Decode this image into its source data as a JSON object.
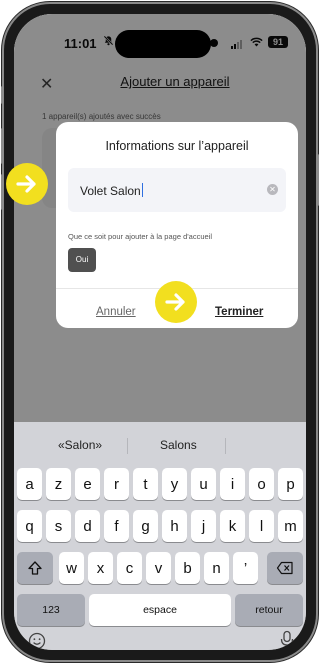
{
  "status_bar": {
    "time": "11:01",
    "mute_icon": "bell-slash-icon",
    "battery": "91"
  },
  "app": {
    "close_icon": "close-icon",
    "title": "Ajouter un appareil",
    "success_text": "1 appareil(s) ajoutés avec succès"
  },
  "dialog": {
    "title": "Informations sur l’appareil",
    "name_value": "Volet Salon",
    "clear_icon": "clear-icon",
    "hint": "Que ce soit pour ajouter à la page d'accueil",
    "yes_label": "Oui",
    "cancel_label": "Annuler",
    "finish_label": "Terminer"
  },
  "markers": {
    "color": "#f2df1f",
    "icon": "arrow-right-icon"
  },
  "keyboard": {
    "suggestions": [
      "«Salon»",
      "Salons",
      ""
    ],
    "row1": [
      "a",
      "z",
      "e",
      "r",
      "t",
      "y",
      "u",
      "i",
      "o",
      "p"
    ],
    "row2": [
      "q",
      "s",
      "d",
      "f",
      "g",
      "h",
      "j",
      "k",
      "l",
      "m"
    ],
    "row3": [
      "w",
      "x",
      "c",
      "v",
      "b",
      "n",
      "’"
    ],
    "shift_icon": "shift-icon",
    "delete_icon": "backspace-icon",
    "numbers_label": "123",
    "space_label": "espace",
    "return_label": "retour",
    "emoji_icon": "emoji-icon",
    "mic_icon": "microphone-icon"
  }
}
